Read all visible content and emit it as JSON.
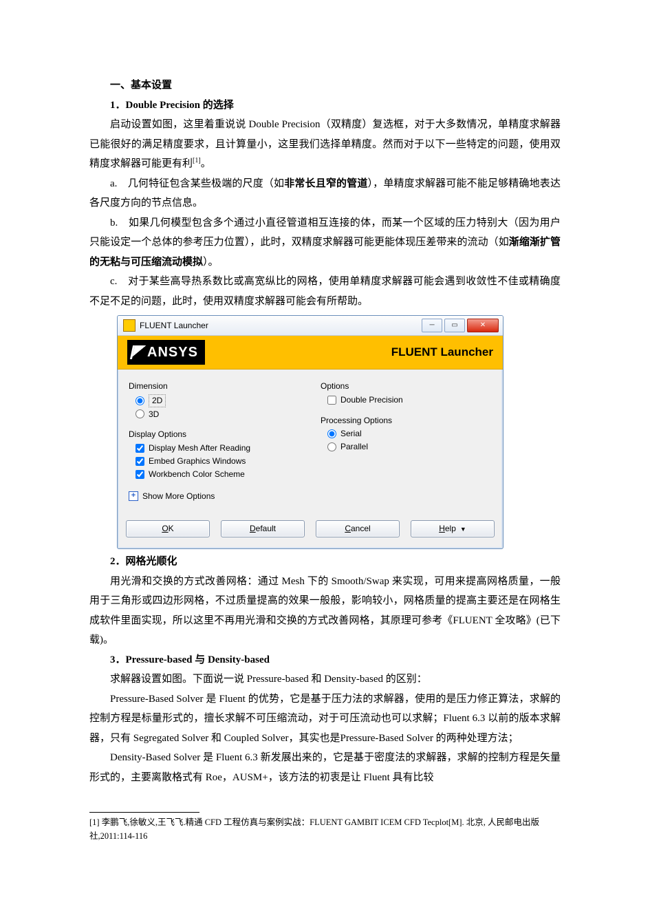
{
  "doc": {
    "h1": "一、基本设置",
    "h2_1": "1．Double Precision 的选择",
    "p1": "启动设置如图，这里着重说说 Double Precision（双精度）复选框，对于大多数情况，单精度求解器已能很好的满足精度要求，且计算量小，这里我们选择单精度。然而对于以下一些特定的问题，使用双精度求解器可能更有利",
    "p1_sup": "[1]",
    "p1_tail": "。",
    "p_a_lead": "a.　几何特征包含某些极端的尺度（如",
    "p_a_bold": "非常长且窄的管道",
    "p_a_tail": "），单精度求解器可能不能足够精确地表达各尺度方向的节点信息。",
    "p_b_lead": "b.　如果几何模型包含多个通过小直径管道相互连接的体，而某一个区域的压力特别大（因为用户只能设定一个总体的参考压力位置），此时，双精度求解器可能更能体现压差带来的流动（如",
    "p_b_bold": "渐缩渐扩管的无粘与可压缩流动模拟",
    "p_b_tail": "）。",
    "p_c": "c.　对于某些高导热系数比或高宽纵比的网格，使用单精度求解器可能会遇到收敛性不佳或精确度不足不足的问题，此时，使用双精度求解器可能会有所帮助。",
    "h2_2": "2．网格光顺化",
    "p2": "用光滑和交换的方式改善网格：通过 Mesh 下的 Smooth/Swap 来实现，可用来提高网格质量，一般用于三角形或四边形网格，不过质量提高的效果一般般，影响较小，网格质量的提高主要还是在网格生成软件里面实现，所以这里不再用光滑和交换的方式改善网格，其原理可参考《FLUENT 全攻略》(已下载)。",
    "h2_3": "3．Pressure-based 与 Density-based",
    "p3a": "求解器设置如图。下面说一说 Pressure-based 和 Density-based 的区别：",
    "p3b": "Pressure-Based  Solver 是 Fluent 的优势，它是基于压力法的求解器，使用的是压力修正算法，求解的控制方程是标量形式的，擅长求解不可压缩流动，对于可压流动也可以求解；Fluent  6.3 以前的版本求解器，只有 Segregated  Solver 和 Coupled  Solver，其实也是Pressure-Based  Solver 的两种处理方法；",
    "p3c": "Density-Based  Solver 是 Fluent 6.3 新发展出来的，它是基于密度法的求解器，求解的控制方程是矢量形式的，主要离散格式有 Roe，AUSM+，该方法的初衷是让 Fluent 具有比较",
    "footnote": "[1] 李鹏飞,徐敏义,王飞飞.精通 CFD 工程仿真与案例实战：FLUENT GAMBIT ICEM CFD Tecplot[M]. 北京, 人民邮电出版社,2011:114-116"
  },
  "launcher": {
    "windowTitle": "FLUENT Launcher",
    "bannerLogo": "ANSYS",
    "bannerRight": "FLUENT Launcher",
    "dimension_label": "Dimension",
    "opt_2d": "2D",
    "opt_3d": "3D",
    "display_options_label": "Display Options",
    "disp1": "Display Mesh After Reading",
    "disp2": "Embed Graphics Windows",
    "disp3": "Workbench Color Scheme",
    "show_more": "Show More Options",
    "options_label": "Options",
    "dp_label": "Double Precision",
    "proc_label": "Processing Options",
    "serial": "Serial",
    "parallel": "Parallel",
    "btn_ok_u": "O",
    "btn_ok_rest": "K",
    "btn_default_u": "D",
    "btn_default_rest": "efault",
    "btn_cancel_u": "C",
    "btn_cancel_rest": "ancel",
    "btn_help_u": "H",
    "btn_help_rest": "elp"
  }
}
